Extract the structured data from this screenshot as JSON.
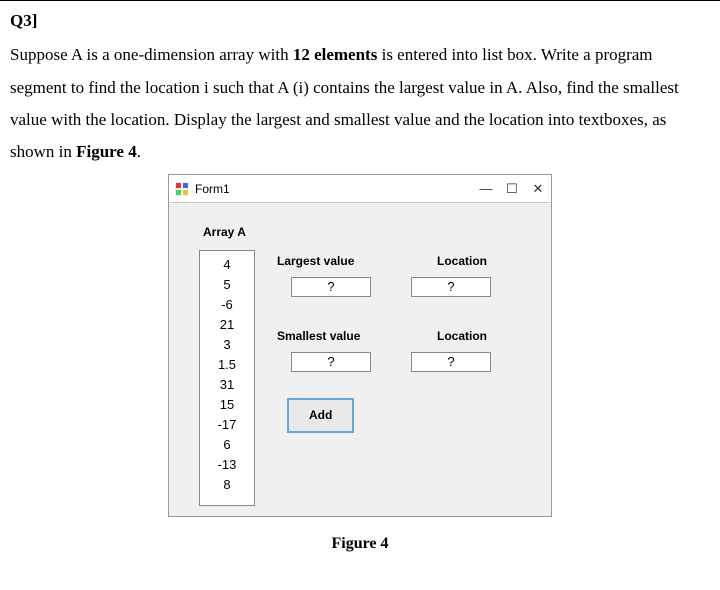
{
  "question": {
    "heading": "Q3]",
    "body_parts": [
      "Suppose A is a one-dimension array with ",
      "12 elements",
      " is entered into list box. Write a program segment to find the location i such that A (i) contains the largest value in A. Also, find the smallest value with the location. Display the largest and smallest value and the location into textboxes, as shown in ",
      "Figure 4",
      "."
    ]
  },
  "window": {
    "title": "Form1",
    "controls": {
      "minimize": "—",
      "maximize": "☐",
      "close": "✕"
    }
  },
  "array_label": "Array A",
  "listbox_items": [
    "4",
    "5",
    "-6",
    "21",
    "3",
    "1.5",
    "31",
    "15",
    "-17",
    "6",
    "-13",
    "8"
  ],
  "labels": {
    "largest_value": "Largest value",
    "location1": "Location",
    "smallest_value": "Smallest value",
    "location2": "Location"
  },
  "textboxes": {
    "largest_value": "?",
    "largest_location": "?",
    "smallest_value": "?",
    "smallest_location": "?"
  },
  "add_button": "Add",
  "figure_caption": "Figure 4"
}
